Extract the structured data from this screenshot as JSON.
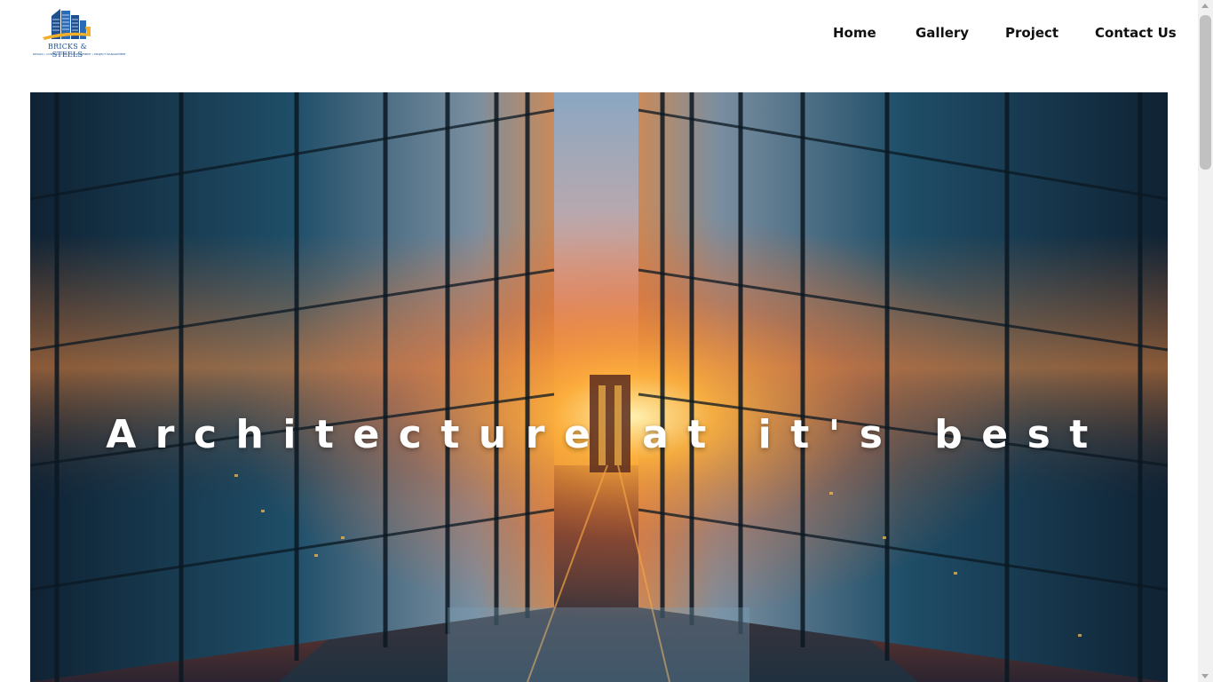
{
  "brand": {
    "name": "BRICKS & STEELS",
    "tagline": "DESIGN • CONSTRUCTION • DEVELOPMENT • PROJECT MANAGEMENT",
    "colors": {
      "blue": "#1d4f91",
      "gold": "#f2b02a"
    }
  },
  "nav": {
    "items": [
      {
        "label": "Home"
      },
      {
        "label": "Gallery"
      },
      {
        "label": "Project"
      },
      {
        "label": "Contact Us"
      }
    ]
  },
  "hero": {
    "title": "Architecture at it's best",
    "image": "glass skyscrapers reflecting a sunset over a bridge"
  },
  "colors": {
    "nav_text": "#111111",
    "hero_text": "#ffffff"
  }
}
